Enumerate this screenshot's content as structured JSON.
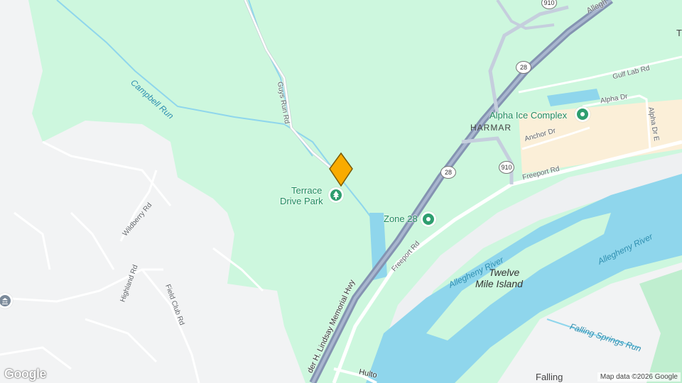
{
  "map": {
    "places": {
      "harmar": "HARMAR",
      "twelve_mile_island_line1": "Twelve",
      "twelve_mile_island_line2": "Mile Island",
      "falling": "Falling",
      "edge_t": "T"
    },
    "water": {
      "campbell_run": "Campbell Run",
      "allegheny_river_1": "Allegheny River",
      "allegheny_river_2": "Allegheny River",
      "falling_springs_run": "Falling Springs Run"
    },
    "roads": {
      "guys_run_rd": "Guys Run Rd",
      "wildberry_rd": "Wildberry Rd",
      "highland_rd": "Highland Rd",
      "field_club_rd": "Field Club Rd",
      "freeport_rd_1": "Freeport Rd",
      "freeport_rd_2": "Freeport Rd",
      "anchor_dr": "Anchor Dr",
      "alpha_dr": "Alpha Dr",
      "alpha_dr_e": "Alpha Dr E",
      "gulf_lab_rd": "Gulf Lab Rd",
      "allegheny_top": "Allegh",
      "memorial_hwy": "der H. Lindsay Memorial Hwy",
      "hulton": "Hulto"
    },
    "shields": {
      "sr910_top": "910",
      "sr28_a": "28",
      "sr28_b": "28",
      "sr910_b": "910"
    },
    "pois": {
      "terrace_drive_park_line1": "Terrace",
      "terrace_drive_park_line2": "Drive Park",
      "zone_28": "Zone 28",
      "alpha_ice_complex": "Alpha Ice Complex"
    },
    "icons": {
      "park": "tree-icon",
      "entertainment": "poi-icon",
      "selected": "map-pin-icon",
      "government": "building-icon"
    },
    "colors": {
      "park_green": "#cdf7de",
      "urban_gray": "#f2f3f4",
      "water_blue": "#8fd6ec",
      "highway": "#8493b1",
      "pin": "#f9ab00",
      "commercial": "#fbefd8"
    },
    "attribution": "Map data ©2026 Google",
    "logo": "Google"
  }
}
